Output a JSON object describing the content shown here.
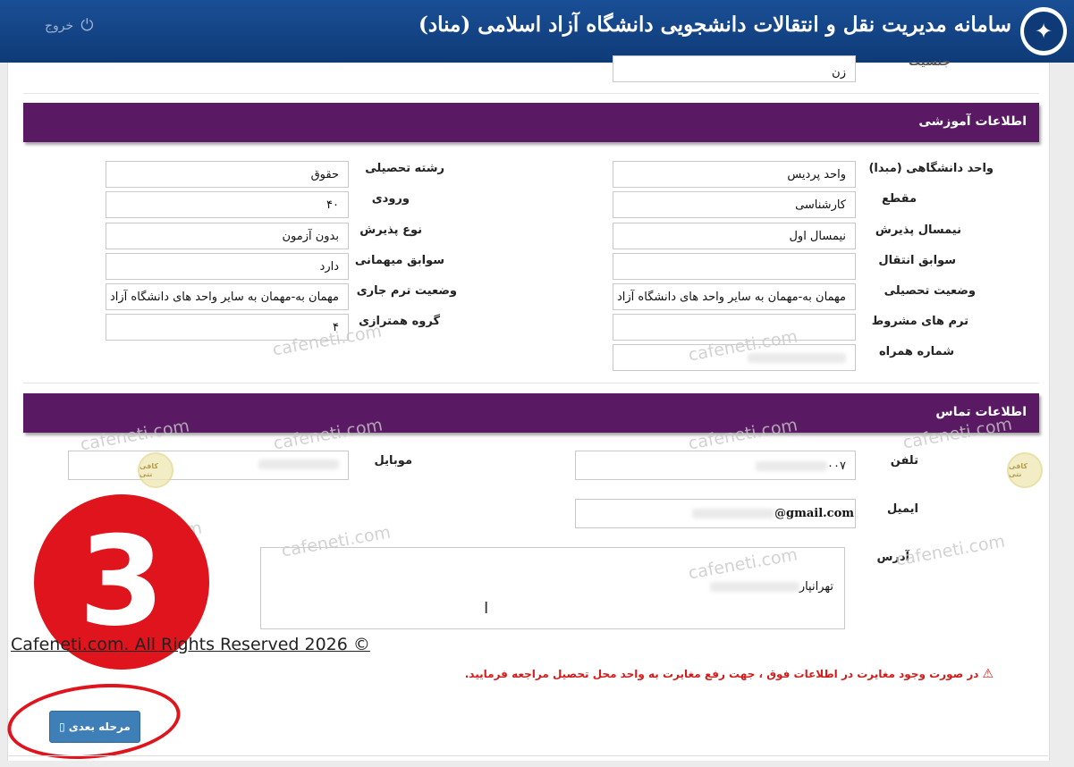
{
  "header": {
    "title": "سامانه مدیریت نقل و انتقالات دانشجویی دانشگاه آزاد اسلامی (مناد)",
    "logout_label": "خروج",
    "logo_icon": "university-logo-icon",
    "logout_icon": "power-icon"
  },
  "personal": {
    "gender_label": "جنسیت",
    "gender_value": "زن"
  },
  "education": {
    "section_title": "اطلاعات آموزشی",
    "right": [
      {
        "label": "واحد دانشگاهی (مبدا)",
        "value": "واحد پردیس"
      },
      {
        "label": "مقطع",
        "value": "کارشناسی"
      },
      {
        "label": "نیمسال پذیرش",
        "value": "نیمسال اول"
      },
      {
        "label": "سوابق انتقال",
        "value": ""
      },
      {
        "label": "وضعیت تحصیلی",
        "value": "مهمان به-مهمان به سایر واحد های دانشگاه آزاد"
      },
      {
        "label": "ترم های مشروط",
        "value": ""
      },
      {
        "label": "شماره همراه",
        "value": ""
      }
    ],
    "left": [
      {
        "label": "رشته تحصیلی",
        "value": "حقوق"
      },
      {
        "label": "ورودی",
        "value": "۴۰"
      },
      {
        "label": "نوع پذیرش",
        "value": "بدون آزمون"
      },
      {
        "label": "سوابق میهمانی",
        "value": "دارد"
      },
      {
        "label": "وضعیت ترم جاری",
        "value": "مهمان به-مهمان به سایر واحد های دانشگاه آزاد"
      },
      {
        "label": "گروه همترازی",
        "value": "۴"
      }
    ]
  },
  "contact": {
    "section_title": "اطلاعات تماس",
    "phone_label": "تلفن",
    "phone_value": "۰۰۷",
    "mobile_label": "موبایل",
    "mobile_value": "",
    "email_label": "ایمیل",
    "email_value": "@gmail.com",
    "address_label": "آدرس",
    "address_value": "تهرانپار"
  },
  "warning": {
    "text": "در صورت وجود مغایرت در اطلاعات فوق ، جهت رفع مغایرت به واحد محل تحصیل مراجعه فرمایید.",
    "icon": "warning-triangle-icon",
    "color": "#d21d1d"
  },
  "next_button": {
    "label": "مرحله بعدی",
    "icon": "arrow-icon",
    "color": "#3f7fb8"
  },
  "overlay": {
    "step_number": "3",
    "copyright": "Cafeneti.com. All Rights Reserved 2026 ©",
    "watermark": "cafeneti.com",
    "badge_text": "کافی نتی",
    "accent": "#e0141c"
  },
  "theme": {
    "header_color": "#0e3a77",
    "section_color": "#5a1a63"
  }
}
